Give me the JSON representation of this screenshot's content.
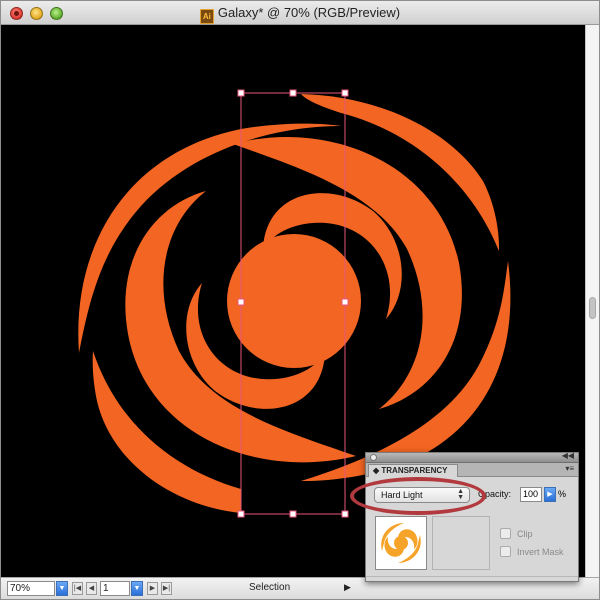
{
  "window": {
    "title": "Galaxy* @ 70% (RGB/Preview)",
    "app_icon": "ai-document-icon"
  },
  "canvas": {
    "background_color": "#000000",
    "art_color": "#f26522",
    "selection_color": "#e8567a"
  },
  "statusbar": {
    "zoom": "70%",
    "page": "1",
    "status": "Selection"
  },
  "transparency_panel": {
    "tab_label": "TRANSPARENCY",
    "blend_mode": "Hard Light",
    "opacity_label": "Opacity:",
    "opacity_value": "100",
    "opacity_unit": "%",
    "clip_label": "Clip",
    "invert_mask_label": "Invert Mask",
    "clip_checked": false,
    "invert_mask_checked": false,
    "thumbnail_color": "#f6a32a"
  },
  "annotation": {
    "color": "#b23a3e"
  }
}
